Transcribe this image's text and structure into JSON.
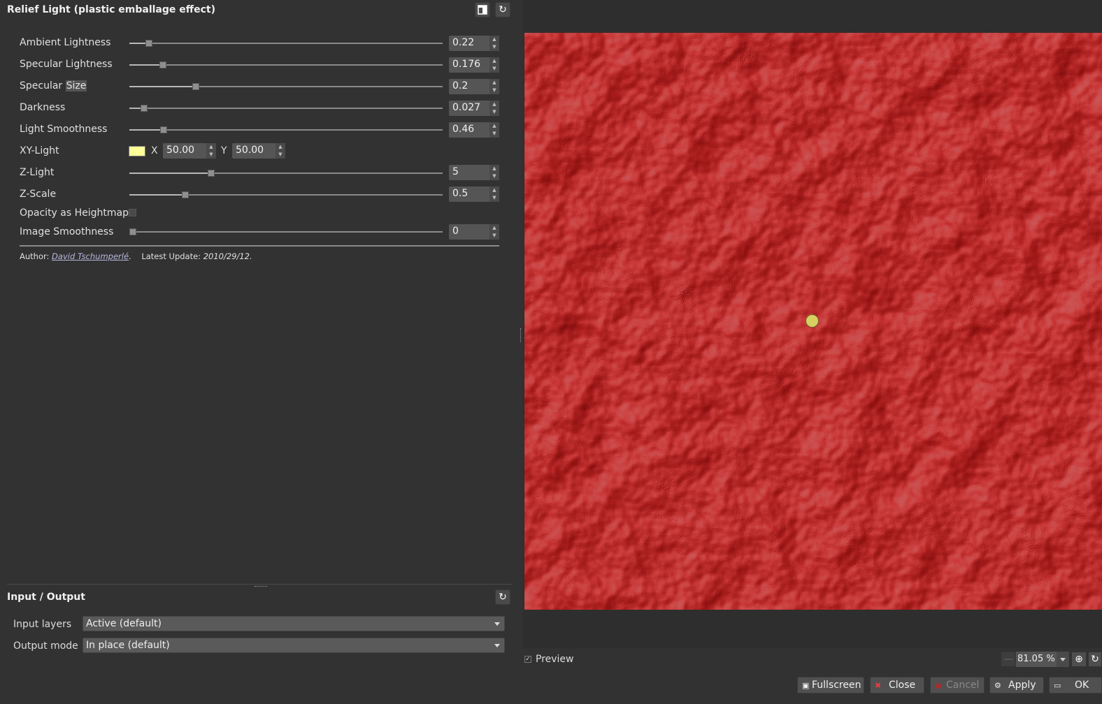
{
  "filter": {
    "title": "Relief Light (plastic emballage effect)"
  },
  "params": {
    "ambient_lightness": {
      "label": "Ambient Lightness",
      "value": "0.22",
      "position": 0.053
    },
    "specular_lightness": {
      "label": "Specular Lightness",
      "value": "0.176",
      "position": 0.098
    },
    "specular_size": {
      "label_a": "Specular",
      "label_b": "Size",
      "value": "0.2",
      "position": 0.205
    },
    "darkness": {
      "label": "Darkness",
      "value": "0.027",
      "position": 0.036
    },
    "light_smoothness": {
      "label": "Light Smoothness",
      "value": "0.46",
      "position": 0.1
    },
    "xy_light": {
      "label": "XY-Light",
      "x_label": "X",
      "x_value": "50.00",
      "y_label": "Y",
      "y_value": "50.00",
      "color": "#ffff99"
    },
    "z_light": {
      "label": "Z-Light",
      "value": "5",
      "position": 0.255
    },
    "z_scale": {
      "label": "Z-Scale",
      "value": "0.5",
      "position": 0.172
    },
    "opacity_heightmap": {
      "label": "Opacity as Heightmap",
      "checked": false
    },
    "image_smoothness": {
      "label": "Image Smoothness",
      "value": "0",
      "position": 0.0
    }
  },
  "credits": {
    "author_prefix": "Author:",
    "author_name": "David Tschumperlé",
    "author_suffix": ".",
    "update_prefix": "Latest Update:",
    "update_date": "2010/29/12."
  },
  "io": {
    "title": "Input / Output",
    "input_label": "Input layers",
    "input_value": "Active (default)",
    "output_label": "Output mode",
    "output_value": "In place (default)"
  },
  "preview": {
    "checkbox_label": "Preview",
    "checked": true,
    "zoom": "81.05 %"
  },
  "buttons": {
    "fullscreen": "Fullscreen",
    "close": "Close",
    "cancel": "Cancel",
    "apply": "Apply",
    "ok": "OK"
  },
  "colors": {
    "background": "#323232",
    "preview_red": "#c01818",
    "light_dot": "#d8cf60"
  }
}
